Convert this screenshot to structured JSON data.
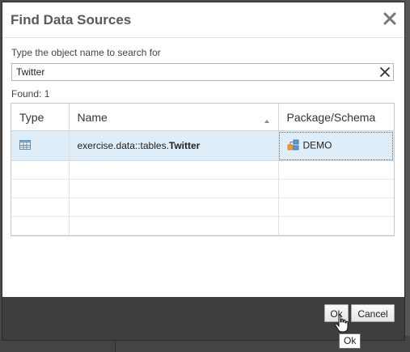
{
  "dialog": {
    "title": "Find Data Sources",
    "prompt": "Type the object name to search for",
    "search": {
      "value": "Twitter",
      "placeholder": ""
    },
    "found_label": "Found: 1"
  },
  "grid": {
    "columns": [
      "Type",
      "Name",
      "Package/Schema"
    ],
    "sorted_column": "Name",
    "rows": [
      {
        "type_icon": "table-icon",
        "name_prefix": "exercise.data::tables.",
        "name_highlight": "Twitter",
        "package_icon": "package-icon",
        "package": "DEMO"
      }
    ]
  },
  "footer": {
    "ok_label": "Ok",
    "cancel_label": "Cancel"
  },
  "tooltip": "Ok",
  "colors": {
    "selected_row": "#dfedf8",
    "footer_bg": "#3e3e3e",
    "title_text": "#5a5a5a"
  }
}
